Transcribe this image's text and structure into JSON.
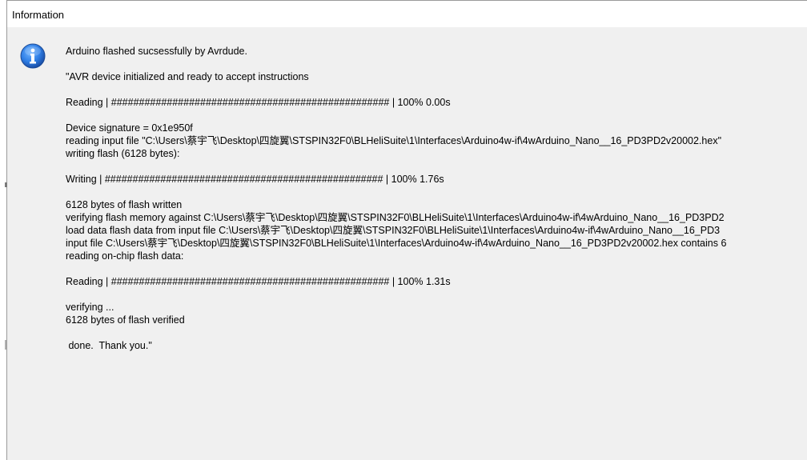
{
  "window": {
    "title": "Information"
  },
  "icon": {
    "name": "information-icon",
    "color": "#1f5fbf"
  },
  "message": {
    "lines": [
      "Arduino flashed sucsessfully by Avrdude.",
      "",
      "\"AVR device initialized and ready to accept instructions",
      "",
      "Reading | ################################################## | 100% 0.00s",
      "",
      "Device signature = 0x1e950f",
      "reading input file \"C:\\Users\\蔡宇飞\\Desktop\\四旋翼\\STSPIN32F0\\BLHeliSuite\\1\\Interfaces\\Arduino4w-if\\4wArduino_Nano__16_PD3PD2v20002.hex\"",
      "writing flash (6128 bytes):",
      "",
      "Writing | ################################################## | 100% 1.76s",
      "",
      "6128 bytes of flash written",
      "verifying flash memory against C:\\Users\\蔡宇飞\\Desktop\\四旋翼\\STSPIN32F0\\BLHeliSuite\\1\\Interfaces\\Arduino4w-if\\4wArduino_Nano__16_PD3PD2",
      "load data flash data from input file C:\\Users\\蔡宇飞\\Desktop\\四旋翼\\STSPIN32F0\\BLHeliSuite\\1\\Interfaces\\Arduino4w-if\\4wArduino_Nano__16_PD3",
      "input file C:\\Users\\蔡宇飞\\Desktop\\四旋翼\\STSPIN32F0\\BLHeliSuite\\1\\Interfaces\\Arduino4w-if\\4wArduino_Nano__16_PD3PD2v20002.hex contains 6",
      "reading on-chip flash data:",
      "",
      "Reading | ################################################## | 100% 1.31s",
      "",
      "verifying ...",
      "6128 bytes of flash verified",
      "",
      " done.  Thank you.\""
    ]
  }
}
